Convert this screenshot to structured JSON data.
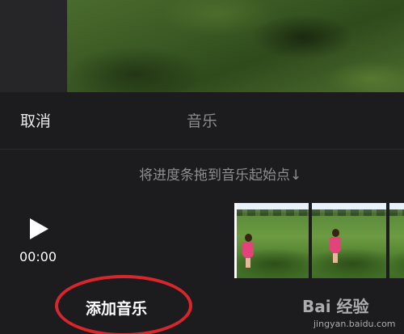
{
  "header": {
    "cancel_label": "取消",
    "title": "音乐"
  },
  "hint": {
    "text": "将进度条拖到音乐起始点↓"
  },
  "player": {
    "play_icon": "play-icon",
    "time": "00:00"
  },
  "timeline": {
    "thumbnails": [
      "clip-frame-1",
      "clip-frame-2",
      "clip-frame-3"
    ]
  },
  "actions": {
    "add_music_label": "添加音乐",
    "highlight_color": "#d9262c"
  },
  "watermark": {
    "logo": "Bai 经验",
    "url": "jingyan.baidu.com"
  }
}
